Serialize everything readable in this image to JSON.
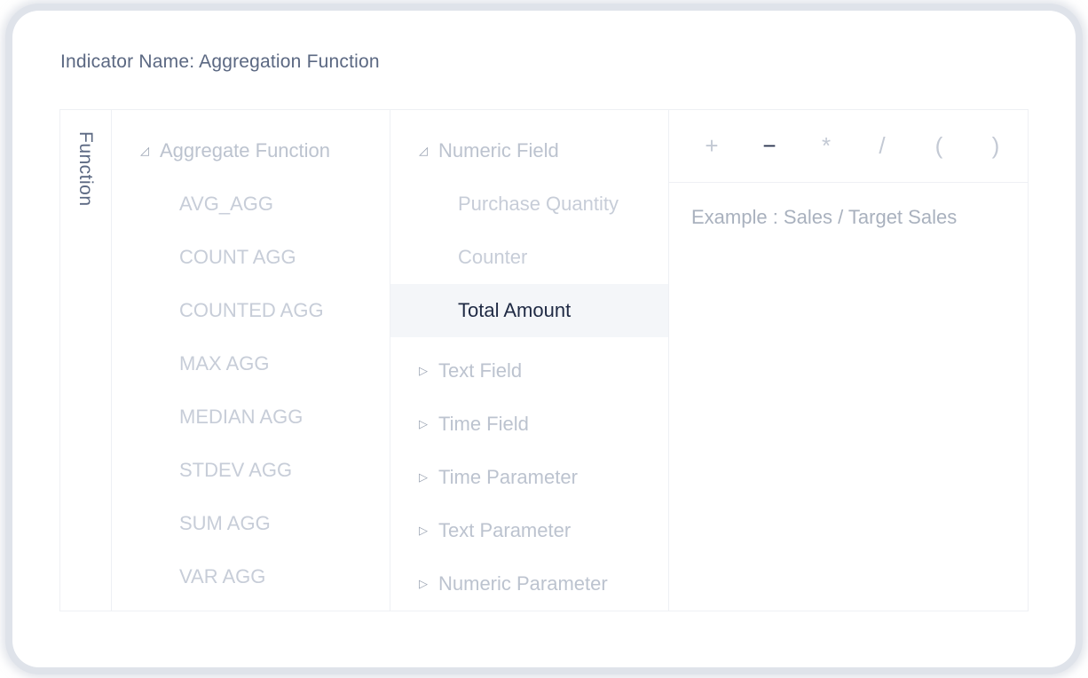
{
  "title": "Indicator Name: Aggregation Function",
  "tab": "Function",
  "aggregate_group": {
    "label": "Aggregate Function",
    "expanded": true,
    "items": [
      "AVG_AGG",
      "COUNT AGG",
      "COUNTED AGG",
      "MAX AGG",
      "MEDIAN AGG",
      "STDEV AGG",
      "SUM AGG",
      "VAR AGG"
    ]
  },
  "field_groups": [
    {
      "label": "Numeric Field",
      "expanded": true,
      "items": [
        "Purchase Quantity",
        "Counter",
        "Total Amount"
      ],
      "selected": "Total Amount"
    },
    {
      "label": "Text Field",
      "expanded": false
    },
    {
      "label": "Time Field",
      "expanded": false
    },
    {
      "label": "Time Parameter",
      "expanded": false
    },
    {
      "label": "Text Parameter",
      "expanded": false
    },
    {
      "label": "Numeric Parameter",
      "expanded": false
    }
  ],
  "operators": [
    "+",
    "−",
    "*",
    "/",
    "(",
    ")"
  ],
  "editor_placeholder": "Example : Sales / Target Sales"
}
